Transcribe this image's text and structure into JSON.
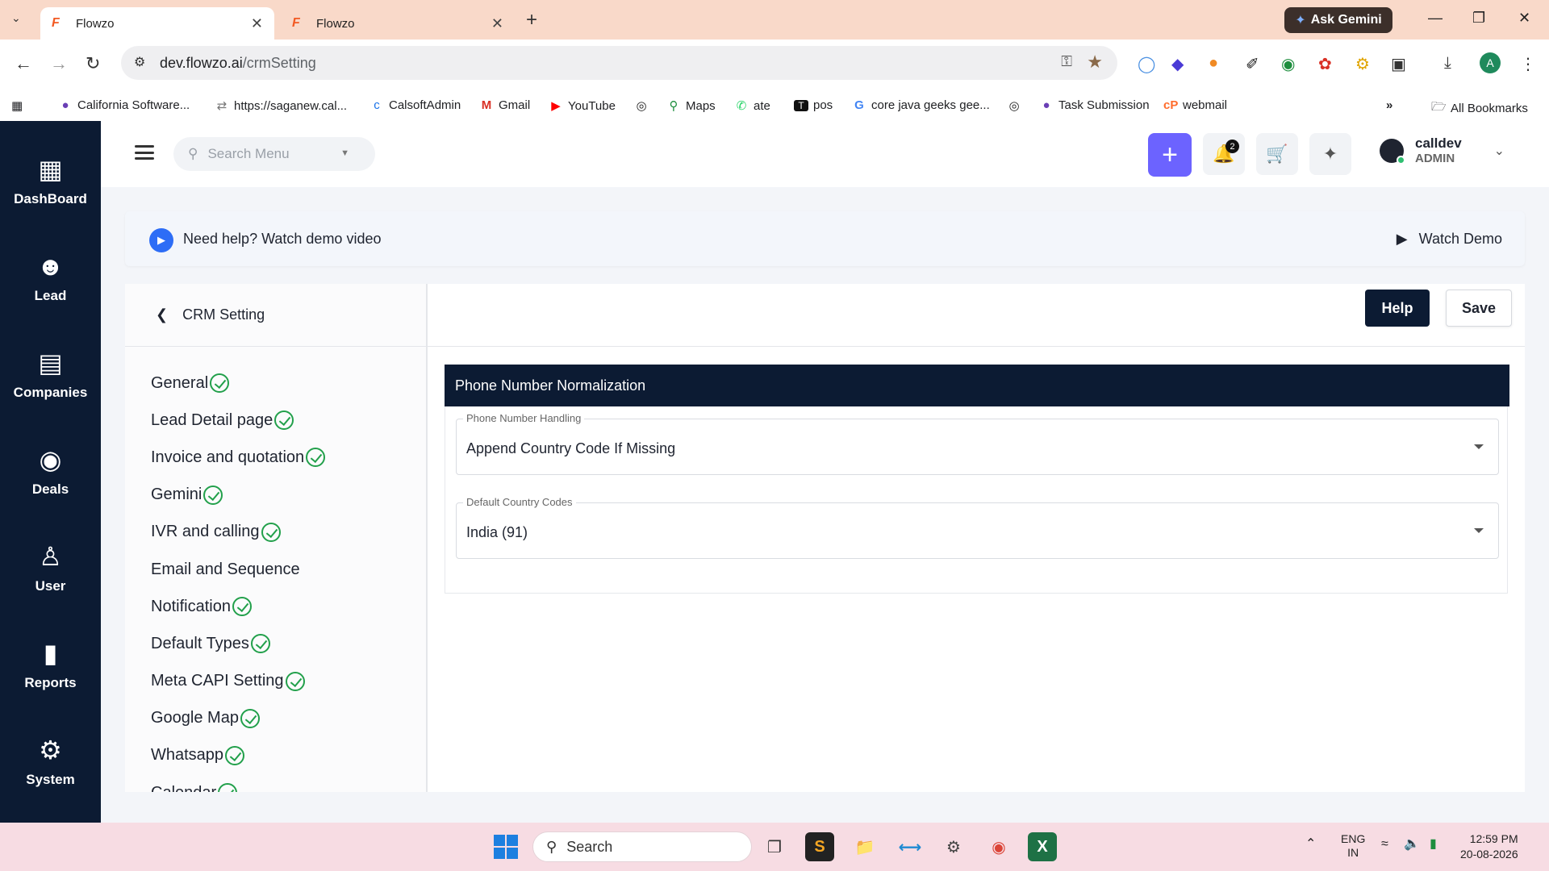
{
  "browser": {
    "tabs": [
      {
        "title": "Flowzo",
        "active": true
      },
      {
        "title": "Flowzo",
        "active": false
      }
    ],
    "ask_gemini": "Ask Gemini",
    "url_host": "dev.flowzo.ai",
    "url_path": "/crmSetting",
    "bookmarks": [
      {
        "label": "California Software...",
        "icon": "org-icon"
      },
      {
        "label": "https://saganew.cal...",
        "icon": "sync-icon"
      },
      {
        "label": "CalsoftAdmin",
        "icon": "c-icon"
      },
      {
        "label": "Gmail",
        "icon": "gmail-icon"
      },
      {
        "label": "YouTube",
        "icon": "youtube-icon"
      },
      {
        "label": "",
        "icon": "globe-icon"
      },
      {
        "label": "Maps",
        "icon": "maps-icon"
      },
      {
        "label": "ate",
        "icon": "whatsapp-icon"
      },
      {
        "label": "pos",
        "icon": "t-icon"
      },
      {
        "label": "core java geeks gee...",
        "icon": "google-icon"
      },
      {
        "label": "",
        "icon": "globe-icon"
      },
      {
        "label": "Task Submission",
        "icon": "org-icon"
      },
      {
        "label": "webmail",
        "icon": "cpanel-icon"
      }
    ],
    "all_bookmarks": "All Bookmarks",
    "profile_initial": "A"
  },
  "sidebar": {
    "items": [
      {
        "label": "DashBoard",
        "icon": "dashboard-icon"
      },
      {
        "label": "Lead",
        "icon": "lead-icon"
      },
      {
        "label": "Companies",
        "icon": "companies-icon"
      },
      {
        "label": "Deals",
        "icon": "deals-icon"
      },
      {
        "label": "User",
        "icon": "user-icon"
      },
      {
        "label": "Reports",
        "icon": "reports-icon"
      },
      {
        "label": "System",
        "icon": "gear-icon"
      }
    ]
  },
  "header": {
    "search_placeholder": "Search Menu",
    "notification_count": "2",
    "user_name": "calldev",
    "user_role": "ADMIN"
  },
  "banner": {
    "text": "Need help? Watch demo video",
    "watch_demo": "Watch Demo"
  },
  "settings": {
    "title": "CRM Setting",
    "nav": [
      {
        "label": "General",
        "checked": true
      },
      {
        "label": "Lead Detail page",
        "checked": true
      },
      {
        "label": "Invoice and quotation",
        "checked": true
      },
      {
        "label": "Gemini",
        "checked": true
      },
      {
        "label": "IVR and calling",
        "checked": true
      },
      {
        "label": "Email and Sequence",
        "checked": false
      },
      {
        "label": "Notification",
        "checked": true
      },
      {
        "label": "Default Types",
        "checked": true
      },
      {
        "label": "Meta CAPI Setting",
        "checked": true
      },
      {
        "label": "Google Map",
        "checked": true
      },
      {
        "label": "Whatsapp",
        "checked": true
      },
      {
        "label": "Calendar",
        "checked": true
      }
    ],
    "help_label": "Help",
    "save_label": "Save",
    "section_title": "Phone Number Normalization",
    "fields": [
      {
        "label": "Phone Number Handling",
        "value": "Append Country Code If Missing"
      },
      {
        "label": "Default Country Codes",
        "value": "India (91)"
      }
    ]
  },
  "taskbar": {
    "search_label": "Search",
    "lang_line1": "ENG",
    "lang_line2": "IN",
    "time": "12:59 PM",
    "date": "20-08-2026"
  }
}
